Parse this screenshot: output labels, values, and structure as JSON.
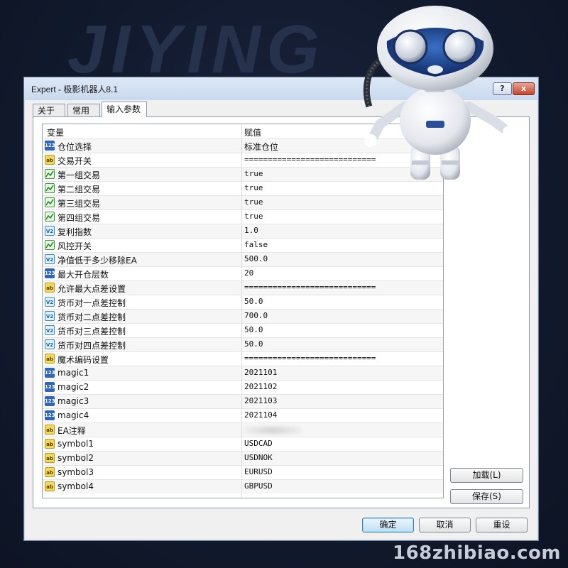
{
  "background": {
    "logo_text": "JIYING",
    "watermark": "168zhibiao.com"
  },
  "window": {
    "title": "Expert - 极影机器人8.1",
    "help_label": "?",
    "close_label": "x"
  },
  "tabs": [
    {
      "label": "关于"
    },
    {
      "label": "常用"
    },
    {
      "label": "输入参数",
      "active": true
    }
  ],
  "grid": {
    "columns": {
      "variable": "变量",
      "value": "赋值"
    },
    "rows": [
      {
        "icon": "int-icon",
        "name": "仓位选择",
        "value": "标准仓位"
      },
      {
        "icon": "string-icon",
        "name": "交易开关",
        "value": "============================"
      },
      {
        "icon": "bool-icon",
        "name": "第一组交易",
        "value": "true"
      },
      {
        "icon": "bool-icon",
        "name": "第二组交易",
        "value": "true"
      },
      {
        "icon": "bool-icon",
        "name": "第三组交易",
        "value": "true"
      },
      {
        "icon": "bool-icon",
        "name": "第四组交易",
        "value": "true"
      },
      {
        "icon": "double-icon",
        "name": "复利指数",
        "value": "1.0"
      },
      {
        "icon": "bool-icon",
        "name": "风控开关",
        "value": "false"
      },
      {
        "icon": "double-icon",
        "name": "净值低于多少移除EA",
        "value": "500.0"
      },
      {
        "icon": "int-icon",
        "name": "最大开仓层数",
        "value": "20"
      },
      {
        "icon": "string-icon",
        "name": "允许最大点差设置",
        "value": "============================"
      },
      {
        "icon": "double-icon",
        "name": "货币对一点差控制",
        "value": "50.0"
      },
      {
        "icon": "double-icon",
        "name": "货币对二点差控制",
        "value": "700.0"
      },
      {
        "icon": "double-icon",
        "name": "货币对三点差控制",
        "value": "50.0"
      },
      {
        "icon": "double-icon",
        "name": "货币对四点差控制",
        "value": "50.0"
      },
      {
        "icon": "string-icon",
        "name": "魔术编码设置",
        "value": "============================"
      },
      {
        "icon": "int-icon",
        "name": "magic1",
        "value": "2021101"
      },
      {
        "icon": "int-icon",
        "name": "magic2",
        "value": "2021102"
      },
      {
        "icon": "int-icon",
        "name": "magic3",
        "value": "2021103"
      },
      {
        "icon": "int-icon",
        "name": "magic4",
        "value": "2021104"
      },
      {
        "icon": "string-icon",
        "name": "EA注释",
        "value": ""
      },
      {
        "icon": "string-icon",
        "name": "symbol1",
        "value": "USDCAD"
      },
      {
        "icon": "string-icon",
        "name": "symbol2",
        "value": "USDNOK"
      },
      {
        "icon": "string-icon",
        "name": "symbol3",
        "value": "EURUSD"
      },
      {
        "icon": "string-icon",
        "name": "symbol4",
        "value": "GBPUSD"
      }
    ]
  },
  "side_buttons": {
    "load": "加载(L)",
    "save": "保存(S)"
  },
  "footer_buttons": {
    "ok": "确定",
    "cancel": "取消",
    "reset": "重设"
  }
}
